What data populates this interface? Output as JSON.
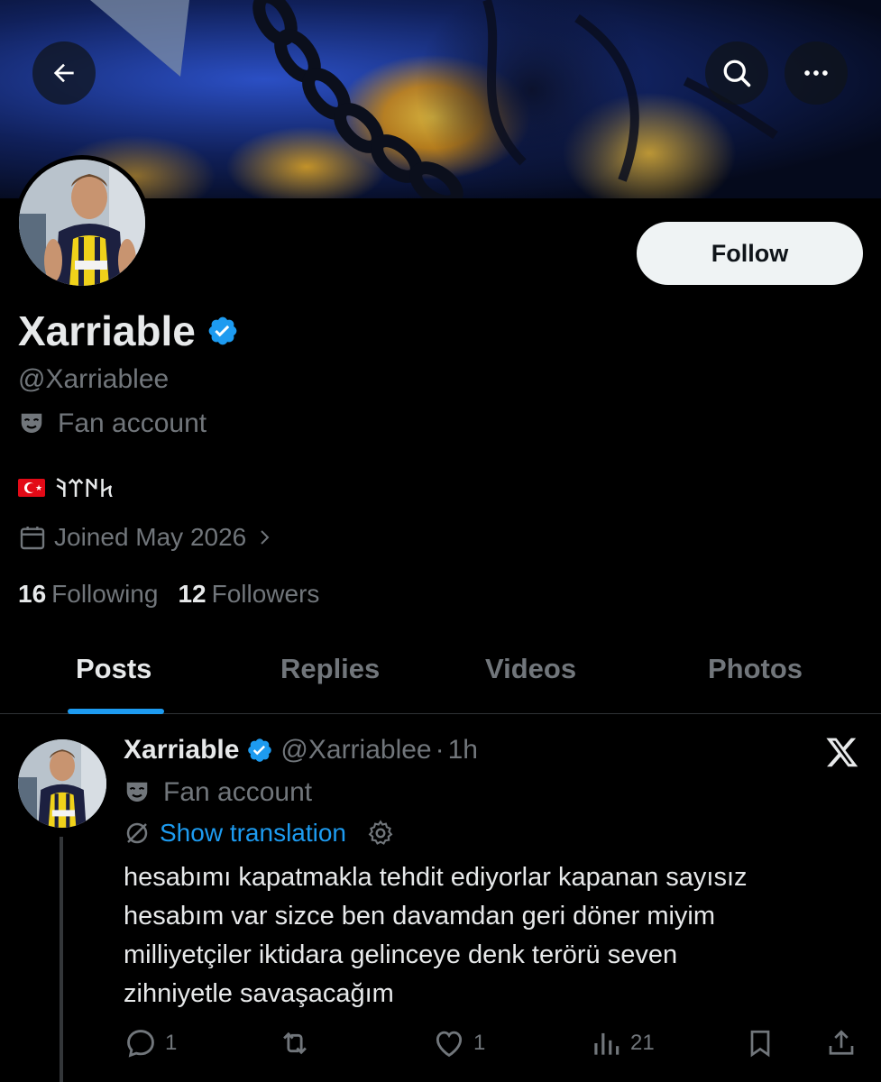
{
  "header": {
    "back_icon": "arrow-left-icon",
    "search_icon": "search-icon",
    "more_icon": "more-horizontal-icon"
  },
  "profile": {
    "display_name": "Xarriable",
    "handle": "@Xarriablee",
    "affiliation": "Fan account",
    "bio": "𐱅𐰇𐰼𐰚",
    "joined": "Joined May 2026",
    "following_count": "16",
    "following_label": "Following",
    "followers_count": "12",
    "followers_label": "Followers",
    "follow_label": "Follow",
    "verified_color": "#1d9bf0"
  },
  "tabs": [
    {
      "label": "Posts",
      "active": true
    },
    {
      "label": "Replies",
      "active": false
    },
    {
      "label": "Videos",
      "active": false
    },
    {
      "label": "Photos",
      "active": false
    }
  ],
  "post": {
    "name": "Xarriable",
    "handle": "@Xarriablee",
    "separator": "·",
    "time": "1h",
    "affiliation": "Fan account",
    "translate_label": "Show translation",
    "text_lines": [
      "hesabımı kapatmakla tehdit ediyorlar kapanan sayısız",
      "hesabım var sizce ben davamdan geri döner miyim",
      "milliyetçiler iktidara gelinceye denk terörü seven",
      "zihniyetle savaşacağım"
    ],
    "replies": "1",
    "reposts": "",
    "likes": "1",
    "views": "21"
  },
  "colors": {
    "background": "#000000",
    "text_primary": "#e7e9ea",
    "text_secondary": "#71767b",
    "accent": "#1d9bf0"
  }
}
